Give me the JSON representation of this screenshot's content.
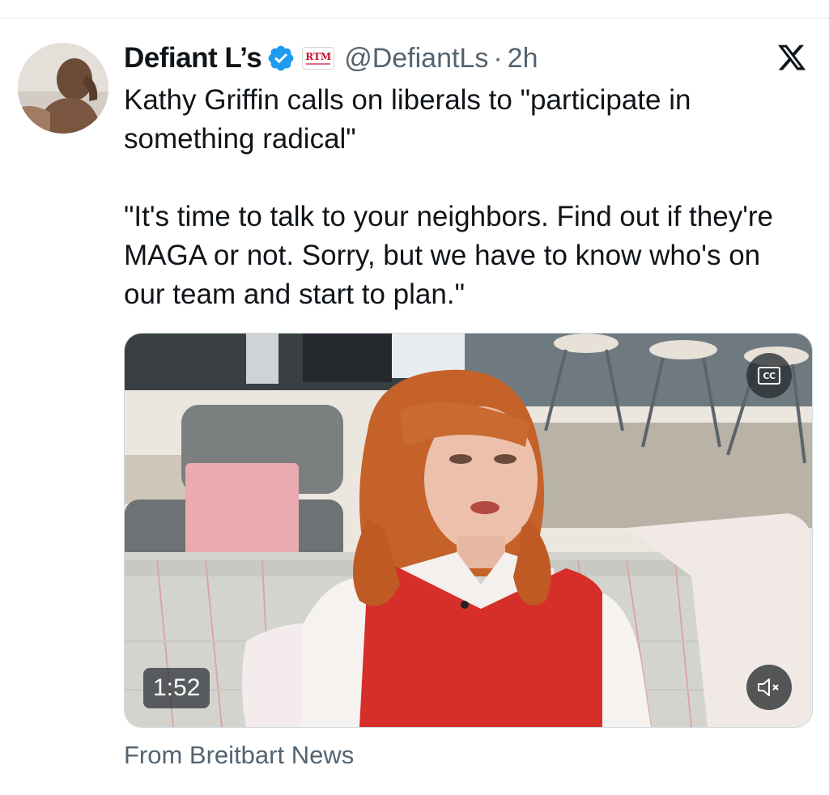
{
  "tweet": {
    "display_name": "Defiant L’s",
    "affiliate_badge_text": "RTM",
    "handle": "@DefiantLs",
    "separator": "·",
    "time": "2h",
    "text_paragraph_1": "Kathy Griffin calls on liberals to \"participate in something radical\"",
    "text_paragraph_2": "\"It's time to talk to your neighbors. Find out if they're MAGA or not. Sorry, but we have to know who's on our team and start to plan.\"",
    "source": "From Breitbart News"
  },
  "video": {
    "duration": "1:52",
    "cc_label": "CC"
  },
  "icons": {
    "verified": "verified-badge-icon",
    "platform": "x-logo-icon",
    "captions": "closed-captions-icon",
    "volume": "volume-muted-icon"
  },
  "colors": {
    "verified_blue": "#1d9bf0",
    "text_primary": "#0f1419",
    "text_secondary": "#536471",
    "affiliate_red": "#c8102e"
  }
}
